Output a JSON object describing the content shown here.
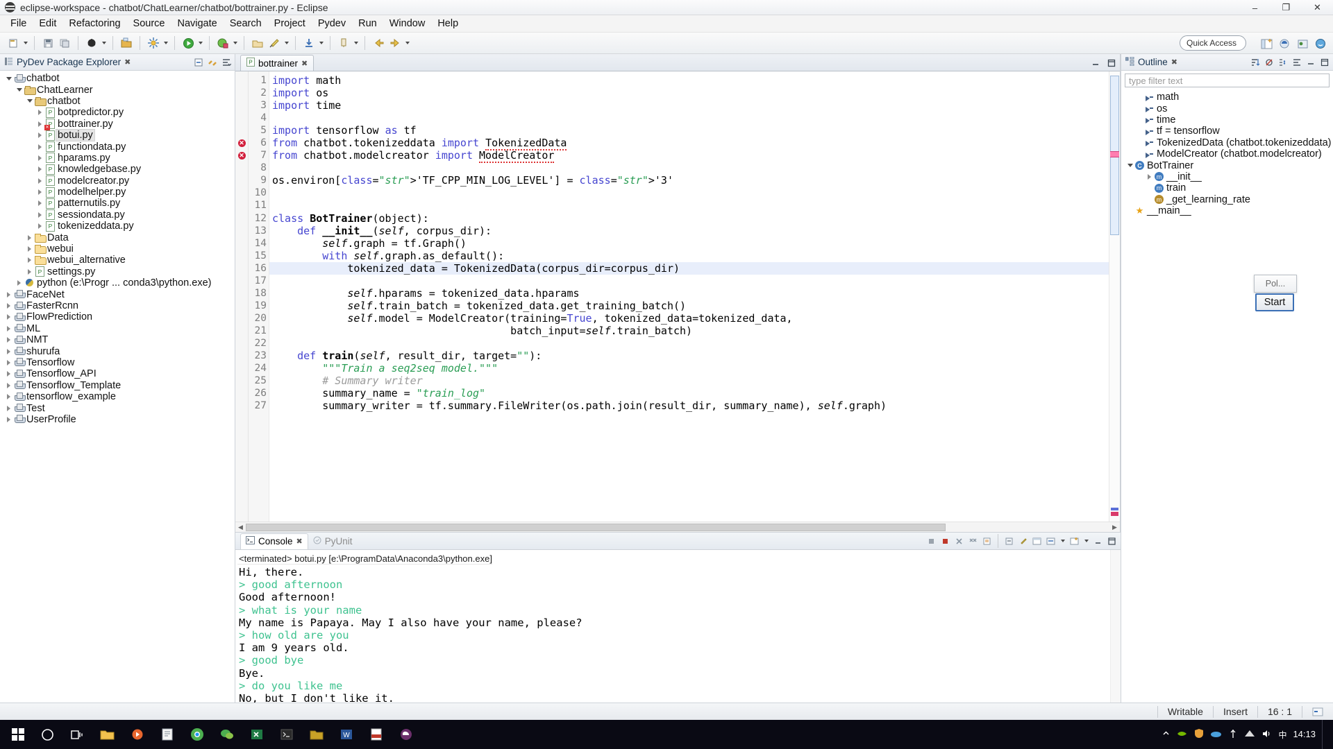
{
  "window": {
    "title": "eclipse-workspace - chatbot/ChatLearner/chatbot/bottrainer.py - Eclipse",
    "minimize": "–",
    "maximize": "❐",
    "close": "✕"
  },
  "menubar": [
    "File",
    "Edit",
    "Refactoring",
    "Source",
    "Navigate",
    "Search",
    "Project",
    "Pydev",
    "Run",
    "Window",
    "Help"
  ],
  "toolbar": {
    "quick_access_placeholder": "Quick Access"
  },
  "explorer": {
    "title": "PyDev Package Explorer",
    "close_glyph": "✖",
    "items": [
      {
        "label": "chatbot",
        "indent": 0,
        "icon": "project-icon",
        "twist": "open"
      },
      {
        "label": "ChatLearner",
        "indent": 1,
        "icon": "package-icon",
        "twist": "open"
      },
      {
        "label": "chatbot",
        "indent": 2,
        "icon": "package-icon",
        "twist": "open"
      },
      {
        "label": "botpredictor.py",
        "indent": 3,
        "icon": "python-file-icon",
        "twist": "closed"
      },
      {
        "label": "bottrainer.py",
        "indent": 3,
        "icon": "python-file-error-icon",
        "twist": "closed"
      },
      {
        "label": "botui.py",
        "indent": 3,
        "icon": "python-file-icon",
        "twist": "closed",
        "selected": true
      },
      {
        "label": "functiondata.py",
        "indent": 3,
        "icon": "python-file-icon",
        "twist": "closed"
      },
      {
        "label": "hparams.py",
        "indent": 3,
        "icon": "python-file-icon",
        "twist": "closed"
      },
      {
        "label": "knowledgebase.py",
        "indent": 3,
        "icon": "python-file-icon",
        "twist": "closed"
      },
      {
        "label": "modelcreator.py",
        "indent": 3,
        "icon": "python-file-icon",
        "twist": "closed"
      },
      {
        "label": "modelhelper.py",
        "indent": 3,
        "icon": "python-file-icon",
        "twist": "closed"
      },
      {
        "label": "patternutils.py",
        "indent": 3,
        "icon": "python-file-icon",
        "twist": "closed"
      },
      {
        "label": "sessiondata.py",
        "indent": 3,
        "icon": "python-file-icon",
        "twist": "closed"
      },
      {
        "label": "tokenizeddata.py",
        "indent": 3,
        "icon": "python-file-icon",
        "twist": "closed"
      },
      {
        "label": "Data",
        "indent": 2,
        "icon": "folder-icon",
        "twist": "closed"
      },
      {
        "label": "webui",
        "indent": 2,
        "icon": "folder-icon",
        "twist": "closed"
      },
      {
        "label": "webui_alternative",
        "indent": 2,
        "icon": "folder-icon",
        "twist": "closed"
      },
      {
        "label": "settings.py",
        "indent": 2,
        "icon": "python-file-icon",
        "twist": "closed"
      },
      {
        "label": "python  (e:\\Progr ... conda3\\python.exe)",
        "indent": 1,
        "icon": "python-interpreter-icon",
        "twist": "closed"
      },
      {
        "label": "FaceNet",
        "indent": 0,
        "icon": "project-icon",
        "twist": "closed"
      },
      {
        "label": "FasterRcnn",
        "indent": 0,
        "icon": "project-icon",
        "twist": "closed"
      },
      {
        "label": "FlowPrediction",
        "indent": 0,
        "icon": "project-icon",
        "twist": "closed"
      },
      {
        "label": "ML",
        "indent": 0,
        "icon": "project-icon",
        "twist": "closed"
      },
      {
        "label": "NMT",
        "indent": 0,
        "icon": "project-icon",
        "twist": "closed"
      },
      {
        "label": "shurufa",
        "indent": 0,
        "icon": "project-icon",
        "twist": "closed"
      },
      {
        "label": "Tensorflow",
        "indent": 0,
        "icon": "project-icon",
        "twist": "closed"
      },
      {
        "label": "Tensorflow_API",
        "indent": 0,
        "icon": "project-icon",
        "twist": "closed"
      },
      {
        "label": "Tensorflow_Template",
        "indent": 0,
        "icon": "project-icon",
        "twist": "closed"
      },
      {
        "label": "tensorflow_example",
        "indent": 0,
        "icon": "project-icon",
        "twist": "closed"
      },
      {
        "label": "Test",
        "indent": 0,
        "icon": "project-icon",
        "twist": "closed"
      },
      {
        "label": "UserProfile",
        "indent": 0,
        "icon": "project-icon",
        "twist": "closed"
      }
    ]
  },
  "editor": {
    "tab_label": "bottrainer",
    "tab_close": "✖",
    "lines": [
      {
        "n": 1,
        "fold": true,
        "error": false,
        "cur": false
      },
      {
        "n": 2,
        "fold": false,
        "error": false,
        "cur": false
      },
      {
        "n": 3,
        "fold": false,
        "error": false,
        "cur": false
      },
      {
        "n": 4,
        "fold": false,
        "error": false,
        "cur": false
      },
      {
        "n": 5,
        "fold": true,
        "error": false,
        "cur": false
      },
      {
        "n": 6,
        "fold": false,
        "error": true,
        "cur": false
      },
      {
        "n": 7,
        "fold": false,
        "error": true,
        "cur": false
      },
      {
        "n": 8,
        "fold": false,
        "error": false,
        "cur": false
      },
      {
        "n": 9,
        "fold": false,
        "error": false,
        "cur": false
      },
      {
        "n": 10,
        "fold": false,
        "error": false,
        "cur": false
      },
      {
        "n": 11,
        "fold": false,
        "error": false,
        "cur": false
      },
      {
        "n": 12,
        "fold": true,
        "error": false,
        "cur": false
      },
      {
        "n": 13,
        "fold": true,
        "error": false,
        "cur": false
      },
      {
        "n": 14,
        "fold": false,
        "error": false,
        "cur": false
      },
      {
        "n": 15,
        "fold": false,
        "error": false,
        "cur": false
      },
      {
        "n": 16,
        "fold": false,
        "error": false,
        "cur": true
      },
      {
        "n": 17,
        "fold": false,
        "error": false,
        "cur": false
      },
      {
        "n": 18,
        "fold": false,
        "error": false,
        "cur": false
      },
      {
        "n": 19,
        "fold": false,
        "error": false,
        "cur": false
      },
      {
        "n": 20,
        "fold": false,
        "error": false,
        "cur": false
      },
      {
        "n": 21,
        "fold": false,
        "error": false,
        "cur": false
      },
      {
        "n": 22,
        "fold": false,
        "error": false,
        "cur": false
      },
      {
        "n": 23,
        "fold": true,
        "error": false,
        "cur": false
      },
      {
        "n": 24,
        "fold": false,
        "error": false,
        "cur": false
      },
      {
        "n": 25,
        "fold": false,
        "error": false,
        "cur": false
      },
      {
        "n": 26,
        "fold": false,
        "error": false,
        "cur": false
      },
      {
        "n": 27,
        "fold": false,
        "error": false,
        "cur": false
      }
    ],
    "source": [
      "import math",
      "import os",
      "import time",
      "",
      "import tensorflow as tf",
      "from chatbot.tokenizeddata import TokenizedData",
      "from chatbot.modelcreator import ModelCreator",
      "",
      "os.environ['TF_CPP_MIN_LOG_LEVEL'] = '3'",
      "",
      "",
      "class BotTrainer(object):",
      "    def __init__(self, corpus_dir):",
      "        self.graph = tf.Graph()",
      "        with self.graph.as_default():",
      "            tokenized_data = TokenizedData(corpus_dir=corpus_dir)",
      "",
      "            self.hparams = tokenized_data.hparams",
      "            self.train_batch = tokenized_data.get_training_batch()",
      "            self.model = ModelCreator(training=True, tokenized_data=tokenized_data,",
      "                                      batch_input=self.train_batch)",
      "",
      "    def train(self, result_dir, target=\"\"):",
      "        \"\"\"Train a seq2seq model.\"\"\"",
      "        # Summary writer",
      "        summary_name = \"train_log\"",
      "        summary_writer = tf.summary.FileWriter(os.path.join(result_dir, summary_name), self.graph)"
    ]
  },
  "console": {
    "tab_active": "Console",
    "tab_close": "✖",
    "tab_inactive": "PyUnit",
    "terminated_line": "<terminated> botui.py [e:\\ProgramData\\Anaconda3\\python.exe]",
    "output": [
      {
        "text": "Hi, there.",
        "user": false
      },
      {
        "text": "> good afternoon",
        "user": true
      },
      {
        "text": "Good afternoon!",
        "user": false
      },
      {
        "text": "> what is your name",
        "user": true
      },
      {
        "text": "My name is Papaya. May I also have your name, please?",
        "user": false
      },
      {
        "text": "> how old are you",
        "user": true
      },
      {
        "text": "I am 9 years old.",
        "user": false
      },
      {
        "text": "> good bye",
        "user": true
      },
      {
        "text": "Bye.",
        "user": false
      },
      {
        "text": "> do you like me",
        "user": true
      },
      {
        "text": "No, but I don't like it.",
        "user": false
      }
    ]
  },
  "outline": {
    "title": "Outline",
    "close_glyph": "✖",
    "filter_placeholder": "type filter text",
    "items": [
      {
        "label": "math",
        "indent": 1,
        "icon": "import-icon",
        "twist": "none"
      },
      {
        "label": "os",
        "indent": 1,
        "icon": "import-icon",
        "twist": "none"
      },
      {
        "label": "time",
        "indent": 1,
        "icon": "import-icon",
        "twist": "none"
      },
      {
        "label": "tf = tensorflow",
        "indent": 1,
        "icon": "import-icon",
        "twist": "none"
      },
      {
        "label": "TokenizedData (chatbot.tokenizeddata)",
        "indent": 1,
        "icon": "import-icon",
        "twist": "none"
      },
      {
        "label": "ModelCreator (chatbot.modelcreator)",
        "indent": 1,
        "icon": "import-icon",
        "twist": "none"
      },
      {
        "label": "BotTrainer",
        "indent": 0,
        "icon": "class-icon",
        "twist": "open"
      },
      {
        "label": "__init__",
        "indent": 2,
        "icon": "method-icon",
        "twist": "closed"
      },
      {
        "label": "train",
        "indent": 2,
        "icon": "method-icon",
        "twist": "none"
      },
      {
        "label": "_get_learning_rate",
        "indent": 2,
        "icon": "method-protected-icon",
        "twist": "none"
      },
      {
        "label": "__main__",
        "indent": 0,
        "icon": "main-icon",
        "twist": "none"
      }
    ]
  },
  "popup": {
    "shell_label": "Pol...",
    "start_label": "Start"
  },
  "statusbar": {
    "writable": "Writable",
    "insert": "Insert",
    "position": "16 : 1"
  },
  "taskbar": {
    "clock_time": "14:13",
    "search_placeholder": ""
  },
  "colors": {
    "keyword": "#4545d0",
    "string": "#2a9d54",
    "comment": "#9a9a9a",
    "error": "#d21f3c",
    "console_user": "#3ec28f",
    "accent": "#3a6fb5"
  }
}
